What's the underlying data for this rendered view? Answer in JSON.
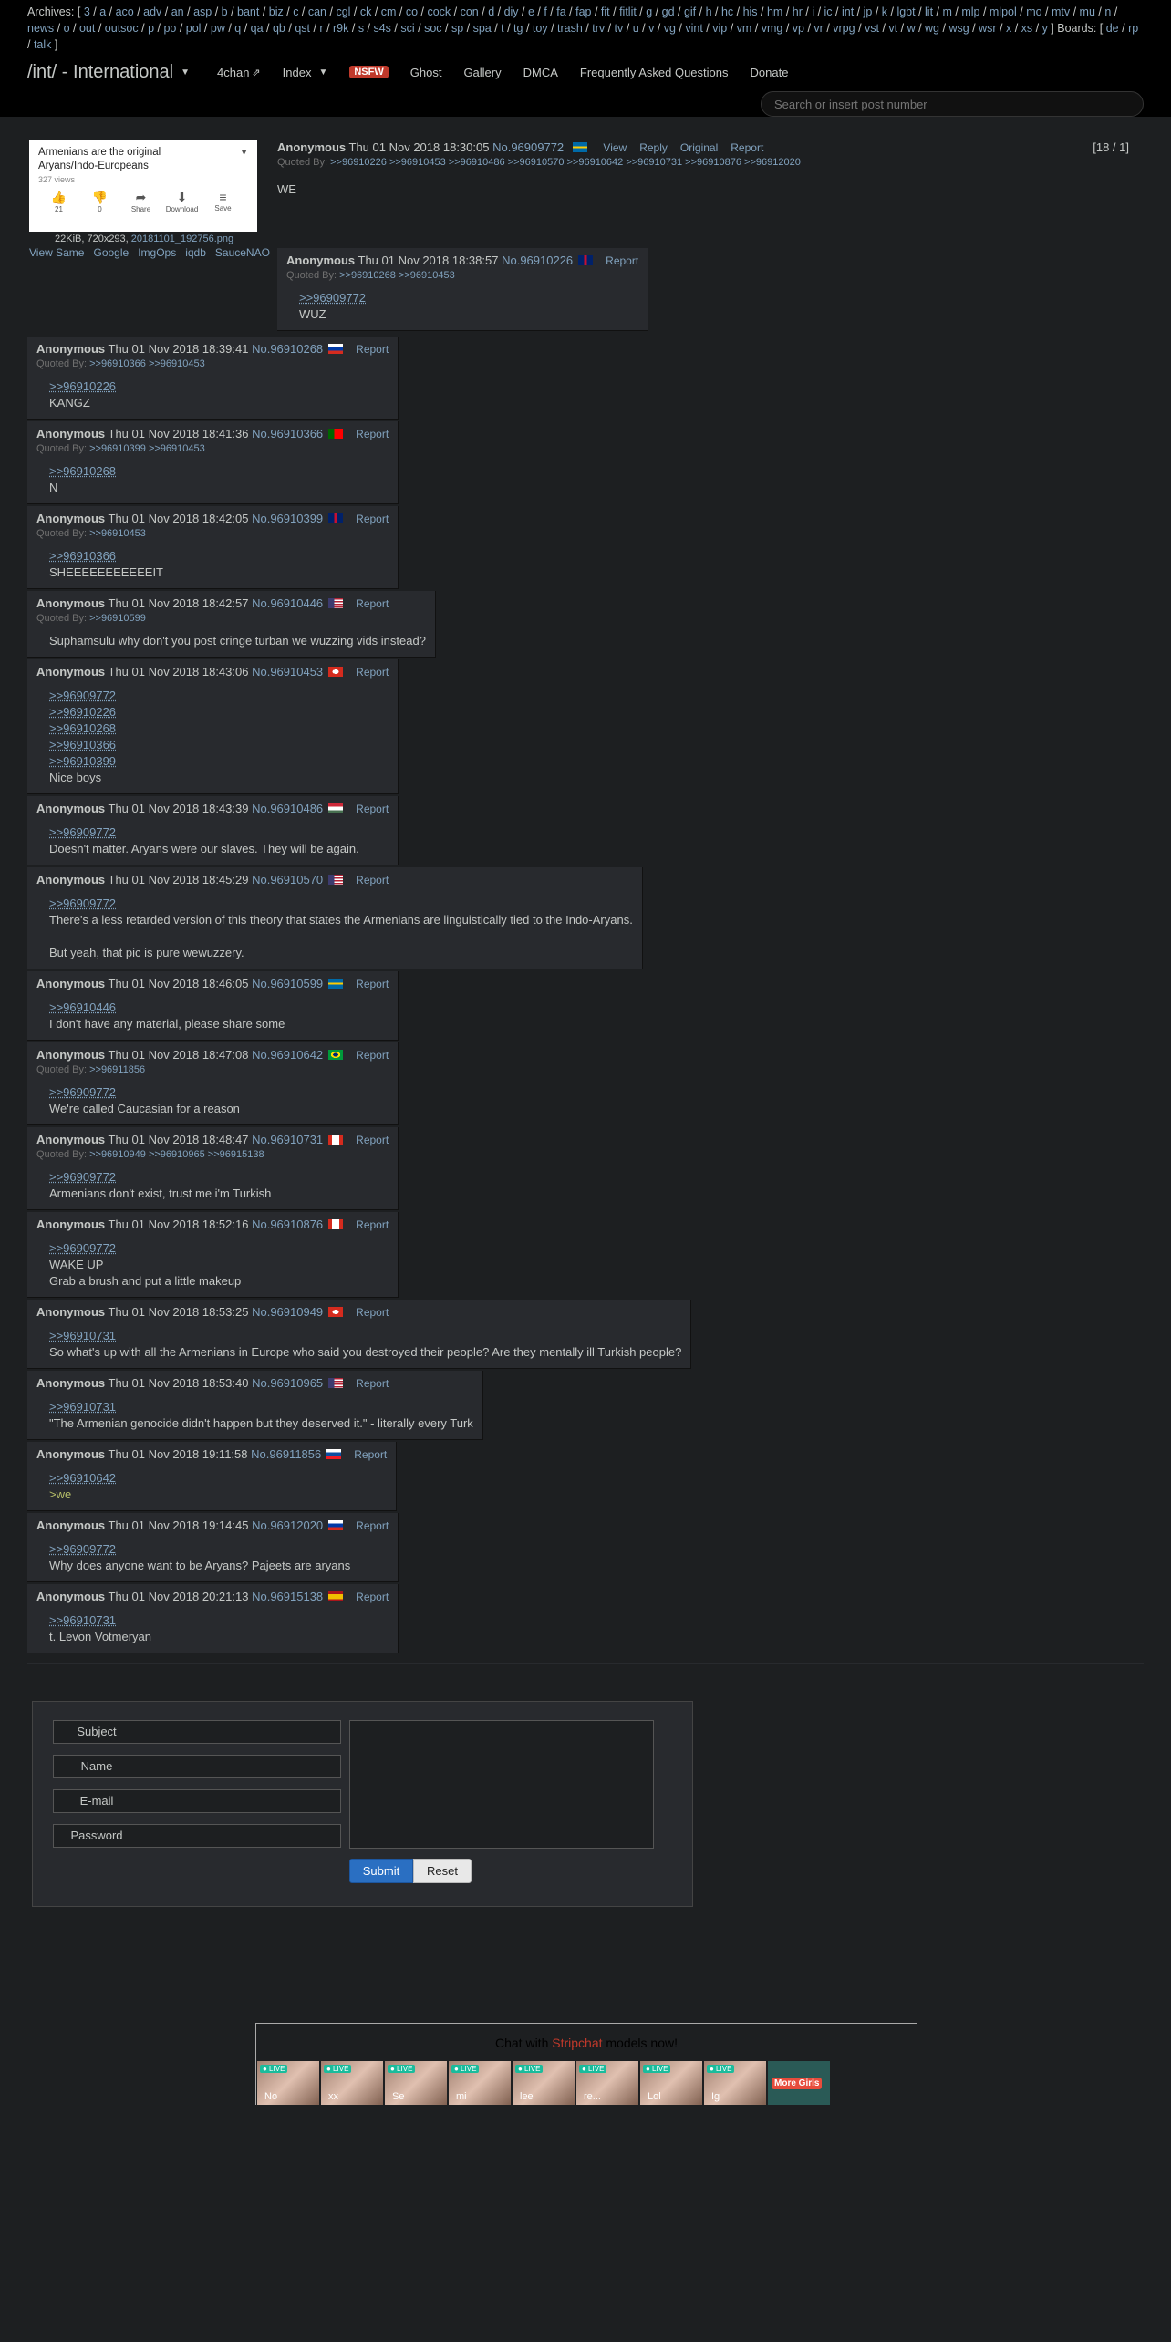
{
  "header": {
    "archives_label": "Archives:",
    "boards": [
      "3",
      "a",
      "aco",
      "adv",
      "an",
      "asp",
      "b",
      "bant",
      "biz",
      "c",
      "can",
      "cgl",
      "ck",
      "cm",
      "co",
      "cock",
      "con",
      "d",
      "diy",
      "e",
      "f",
      "fa",
      "fap",
      "fit",
      "fitlit",
      "g",
      "gd",
      "gif",
      "h",
      "hc",
      "his",
      "hm",
      "hr",
      "i",
      "ic",
      "int",
      "jp",
      "k",
      "lgbt",
      "lit",
      "m",
      "mlp",
      "mlpol",
      "mo",
      "mtv",
      "mu",
      "n",
      "news",
      "o",
      "out",
      "outsoc",
      "p",
      "po",
      "pol",
      "pw",
      "q",
      "qa",
      "qb",
      "qst",
      "r",
      "r9k",
      "s",
      "s4s",
      "sci",
      "soc",
      "sp",
      "spa",
      "t",
      "tg",
      "toy",
      "trash",
      "trv",
      "tv",
      "u",
      "v",
      "vg",
      "vint",
      "vip",
      "vm",
      "vmg",
      "vp",
      "vr",
      "vrpg",
      "vst",
      "vt",
      "w",
      "wg",
      "wsg",
      "wsr",
      "x",
      "xs",
      "y"
    ],
    "boards_label": "Boards:",
    "lang_boards": [
      "de",
      "rp",
      "talk"
    ],
    "board_title": "/int/ - International",
    "nav": {
      "fourchan": "4chan",
      "index": "Index",
      "nsfw": "NSFW",
      "ghost": "Ghost",
      "gallery": "Gallery",
      "dmca": "DMCA",
      "faq": "Frequently Asked Questions",
      "donate": "Donate"
    },
    "search_placeholder": "Search or insert post number"
  },
  "op": {
    "thumb_title": "Armenians are the original Aryans/Indo-Europeans",
    "thumb_views": "327 views",
    "thumb_actions": [
      {
        "icon": "thumbs-up-icon",
        "num": "21"
      },
      {
        "icon": "thumbs-down-icon",
        "num": "0"
      },
      {
        "icon": "share-icon",
        "num": "Share"
      },
      {
        "icon": "download-icon",
        "num": "Download"
      },
      {
        "icon": "save-icon",
        "num": "Save"
      }
    ],
    "file_size": "22KiB, 720x293,",
    "file_name": "20181101_192756.png",
    "image_links": [
      "View Same",
      "Google",
      "ImgOps",
      "iqdb",
      "SauceNAO"
    ],
    "name": "Anonymous",
    "date": "Thu 01 Nov 2018 18:30:05",
    "num": "No.96909772",
    "flag": "se",
    "menu": [
      "View",
      "Reply",
      "Original",
      "Report"
    ],
    "counter": "[18 / 1]",
    "quoted_by": ">>96910226 >>96910453 >>96910486 >>96910570 >>96910642 >>96910731 >>96910876 >>96912020",
    "text": "WE"
  },
  "replies": [
    {
      "date": "Thu 01 Nov 2018 18:38:57",
      "num": "No.96910226",
      "flag": "gb",
      "quoted": ">>96910268 >>96910453",
      "lines": [
        {
          "t": ">>96909772",
          "k": "q"
        },
        {
          "t": "WUZ",
          "k": "p"
        }
      ]
    },
    {
      "date": "Thu 01 Nov 2018 18:39:41",
      "num": "No.96910268",
      "flag": "ru",
      "quoted": ">>96910366 >>96910453",
      "lines": [
        {
          "t": ">>96910226",
          "k": "q"
        },
        {
          "t": "KANGZ",
          "k": "p"
        }
      ]
    },
    {
      "date": "Thu 01 Nov 2018 18:41:36",
      "num": "No.96910366",
      "flag": "pt",
      "quoted": ">>96910399 >>96910453",
      "lines": [
        {
          "t": ">>96910268",
          "k": "q"
        },
        {
          "t": "N",
          "k": "p"
        }
      ]
    },
    {
      "date": "Thu 01 Nov 2018 18:42:05",
      "num": "No.96910399",
      "flag": "gb",
      "quoted": ">>96910453",
      "lines": [
        {
          "t": ">>96910366",
          "k": "q"
        },
        {
          "t": "SHEEEEEEEEEEEIT",
          "k": "p"
        }
      ]
    },
    {
      "date": "Thu 01 Nov 2018 18:42:57",
      "num": "No.96910446",
      "flag": "us",
      "quoted": ">>96910599",
      "lines": [
        {
          "t": "Suphamsulu why don't you post cringe turban we wuzzing vids instead?",
          "k": "p"
        }
      ]
    },
    {
      "date": "Thu 01 Nov 2018 18:43:06",
      "num": "No.96910453",
      "flag": "ch",
      "quoted": "",
      "lines": [
        {
          "t": ">>96909772",
          "k": "q"
        },
        {
          "t": ">>96910226",
          "k": "q"
        },
        {
          "t": ">>96910268",
          "k": "q"
        },
        {
          "t": ">>96910366",
          "k": "q"
        },
        {
          "t": ">>96910399",
          "k": "q"
        },
        {
          "t": "Nice boys",
          "k": "p"
        }
      ]
    },
    {
      "date": "Thu 01 Nov 2018 18:43:39",
      "num": "No.96910486",
      "flag": "hu",
      "quoted": "",
      "lines": [
        {
          "t": ">>96909772",
          "k": "q"
        },
        {
          "t": "Doesn't matter. Aryans were our slaves. They will be again.",
          "k": "p"
        }
      ]
    },
    {
      "date": "Thu 01 Nov 2018 18:45:29",
      "num": "No.96910570",
      "flag": "us",
      "quoted": "",
      "lines": [
        {
          "t": ">>96909772",
          "k": "q"
        },
        {
          "t": "There's a less retarded version of this theory that states the Armenians are linguistically tied to the Indo-Aryans.",
          "k": "p"
        },
        {
          "t": "",
          "k": "p"
        },
        {
          "t": "But yeah, that pic is pure wewuzzery.",
          "k": "p"
        }
      ]
    },
    {
      "date": "Thu 01 Nov 2018 18:46:05",
      "num": "No.96910599",
      "flag": "se",
      "quoted": "",
      "lines": [
        {
          "t": ">>96910446",
          "k": "q"
        },
        {
          "t": "I don't have any material, please share some",
          "k": "p"
        }
      ]
    },
    {
      "date": "Thu 01 Nov 2018 18:47:08",
      "num": "No.96910642",
      "flag": "br",
      "quoted": ">>96911856",
      "lines": [
        {
          "t": ">>96909772",
          "k": "q"
        },
        {
          "t": "We're called Caucasian for a reason",
          "k": "p"
        }
      ]
    },
    {
      "date": "Thu 01 Nov 2018 18:48:47",
      "num": "No.96910731",
      "flag": "ca",
      "quoted": ">>96910949 >>96910965 >>96915138",
      "lines": [
        {
          "t": ">>96909772",
          "k": "q"
        },
        {
          "t": "Armenians don't exist, trust me i'm Turkish",
          "k": "p"
        }
      ]
    },
    {
      "date": "Thu 01 Nov 2018 18:52:16",
      "num": "No.96910876",
      "flag": "ca",
      "quoted": "",
      "lines": [
        {
          "t": ">>96909772",
          "k": "q"
        },
        {
          "t": "WAKE UP",
          "k": "p"
        },
        {
          "t": "Grab a brush and put a little makeup",
          "k": "p"
        }
      ]
    },
    {
      "date": "Thu 01 Nov 2018 18:53:25",
      "num": "No.96910949",
      "flag": "ch",
      "quoted": "",
      "lines": [
        {
          "t": ">>96910731",
          "k": "q"
        },
        {
          "t": "So what's up with all the Armenians in Europe who said you destroyed their people? Are they mentally ill Turkish people?",
          "k": "p"
        }
      ]
    },
    {
      "date": "Thu 01 Nov 2018 18:53:40",
      "num": "No.96910965",
      "flag": "us",
      "quoted": "",
      "lines": [
        {
          "t": ">>96910731",
          "k": "q"
        },
        {
          "t": "\"The Armenian genocide didn't happen but they deserved it.\" - literally every Turk",
          "k": "p"
        }
      ]
    },
    {
      "date": "Thu 01 Nov 2018 19:11:58",
      "num": "No.96911856",
      "flag": "sk",
      "quoted": "",
      "lines": [
        {
          "t": ">>96910642",
          "k": "q"
        },
        {
          "t": ">we",
          "k": "g"
        }
      ]
    },
    {
      "date": "Thu 01 Nov 2018 19:14:45",
      "num": "No.96912020",
      "flag": "ru",
      "quoted": "",
      "lines": [
        {
          "t": ">>96909772",
          "k": "q"
        },
        {
          "t": "Why does anyone want to be Aryans? Pajeets are aryans",
          "k": "p"
        }
      ]
    },
    {
      "date": "Thu 01 Nov 2018 20:21:13",
      "num": "No.96915138",
      "flag": "es",
      "quoted": "",
      "lines": [
        {
          "t": ">>96910731",
          "k": "q"
        },
        {
          "t": "t. Levon Votmeryan",
          "k": "p"
        }
      ]
    }
  ],
  "reply_common": {
    "name": "Anonymous",
    "report": "Report",
    "quoted_label": "Quoted By:"
  },
  "form": {
    "subject": "Subject",
    "name": "Name",
    "email": "E-mail",
    "password": "Password",
    "submit": "Submit",
    "reset": "Reset"
  },
  "ad": {
    "title_a": "Chat with",
    "brand": "Stripchat",
    "title_b": "models now!",
    "live": "LIVE",
    "tiles": [
      "No",
      "xx",
      "Se",
      "mi",
      "lee",
      "re...",
      "Lol",
      "Ig",
      ""
    ],
    "more": "More Girls"
  },
  "colors": {
    "bg": "#1d1f21",
    "post": "#282a2e",
    "link": "#81a2be",
    "greentext": "#b5bd68",
    "nsfw": "#c0392b"
  }
}
